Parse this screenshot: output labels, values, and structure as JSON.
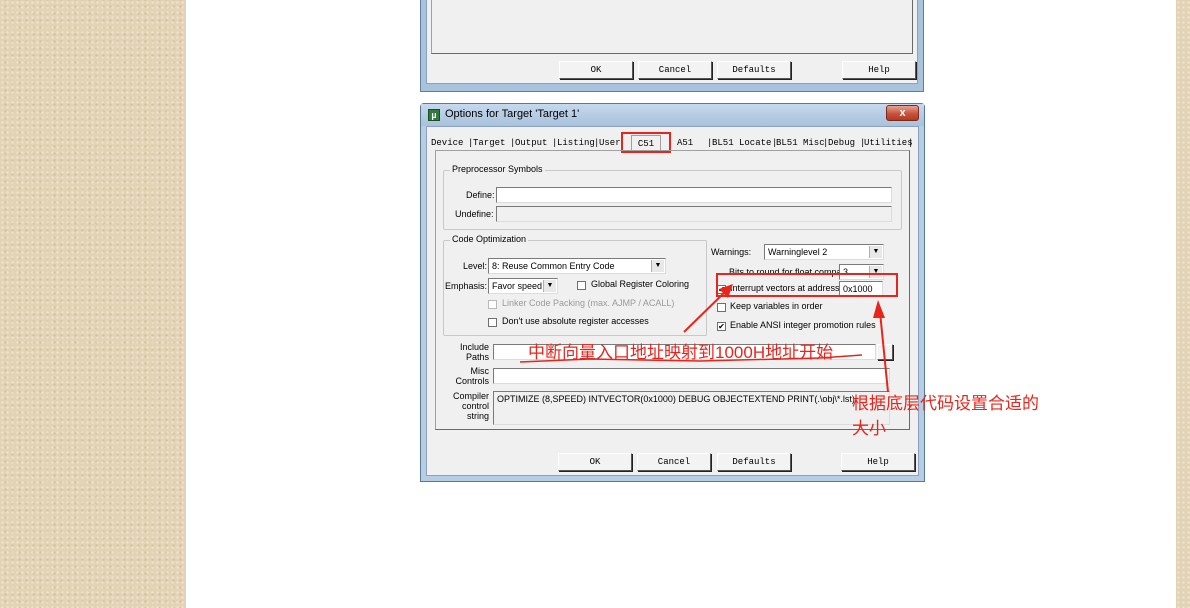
{
  "top_dialog": {
    "buttons": [
      "OK",
      "Cancel",
      "Defaults",
      "Help"
    ]
  },
  "dialog": {
    "title": "Options for Target 'Target 1'",
    "close_glyph": "x",
    "app_icon": "µ",
    "tabs": [
      "Device",
      "Target",
      "Output",
      "Listing",
      "User",
      "C51",
      "A51",
      "BL51 Locate",
      "BL51 Misc",
      "Debug",
      "Utilities"
    ],
    "active_tab": "C51",
    "preprocessor": {
      "title": "Preprocessor Symbols",
      "define_label": "Define:",
      "define_value": "",
      "undefine_label": "Undefine:",
      "undefine_value": ""
    },
    "code_opt": {
      "title": "Code Optimization",
      "level_label": "Level:",
      "level_value": "8: Reuse Common Entry Code",
      "emphasis_label": "Emphasis:",
      "emphasis_value": "Favor speed",
      "global_reg": "Global Register Coloring",
      "global_reg_checked": false,
      "linker_packing": "Linker Code Packing (max. AJMP / ACALL)",
      "linker_packing_checked": false,
      "no_abs_reg": "Don't use absolute register accesses",
      "no_abs_reg_checked": false
    },
    "right": {
      "warnings_label": "Warnings:",
      "warnings_value": "Warninglevel 2",
      "bits_label": "Bits to round for float compare:",
      "bits_value": "3",
      "interrupt_label": "Interrupt vectors at address:",
      "interrupt_checked": true,
      "interrupt_value": "0x1000",
      "keep_vars": "Keep variables in order",
      "keep_vars_checked": false,
      "ansi": "Enable ANSI integer promotion rules",
      "ansi_checked": true
    },
    "include_label_1": "Include",
    "include_label_2": "Paths",
    "misc_label_1": "Misc",
    "misc_label_2": "Controls",
    "compiler_label_1": "Compiler",
    "compiler_label_2": "control",
    "compiler_label_3": "string",
    "compiler_string": "OPTIMIZE (8,SPEED) INTVECTOR(0x1000) DEBUG OBJECTEXTEND PRINT(.\\obj\\*.lst)",
    "buttons": [
      "OK",
      "Cancel",
      "Defaults",
      "Help"
    ],
    "check_glyph": "✔"
  },
  "annotations": {
    "mapping_note": "中断向量入口地址映射到1000H地址开始",
    "size_note_line1": "根据底层代码设置合适的",
    "size_note_line2": "大小",
    "color": "#e8251c"
  }
}
